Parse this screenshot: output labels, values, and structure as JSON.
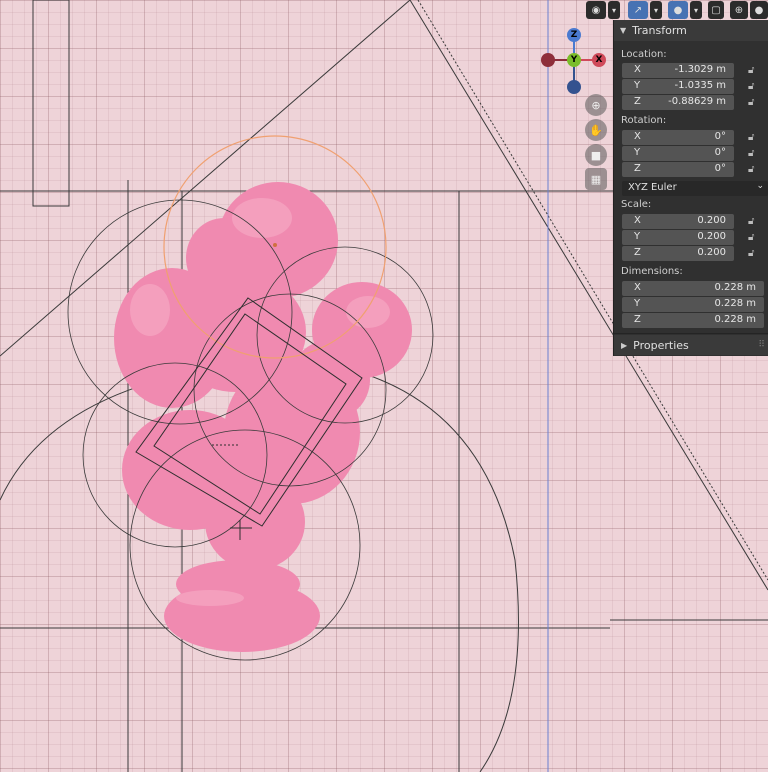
{
  "viewport": {
    "theme_colors": {
      "background": "#eed3d8",
      "object": "#f08ab0",
      "selection_outline": "#f0a070"
    }
  },
  "header": {
    "buttons": [
      {
        "icon": "eye-icon",
        "active": false
      },
      {
        "icon": "gizmo-arrows-icon",
        "active": true
      },
      {
        "icon": "overlay-circles-icon",
        "active": true
      },
      {
        "icon": "xray-toggle-icon",
        "active": false
      },
      {
        "icon": "shading-wireframe-icon",
        "active": false
      },
      {
        "icon": "shading-solid-icon",
        "active": false
      },
      {
        "icon": "shading-material-icon",
        "active": true
      },
      {
        "icon": "shading-rendered-icon",
        "active": false
      }
    ]
  },
  "gizmo": {
    "z": "Z",
    "y": "Y",
    "x": "X"
  },
  "panel": {
    "transform_title": "Transform",
    "location": {
      "label": "Location:",
      "x": {
        "label": "X",
        "value": "-1.3029 m"
      },
      "y": {
        "label": "Y",
        "value": "-1.0335 m"
      },
      "z": {
        "label": "Z",
        "value": "-0.88629 m"
      }
    },
    "rotation": {
      "label": "Rotation:",
      "x": {
        "label": "X",
        "value": "0°"
      },
      "y": {
        "label": "Y",
        "value": "0°"
      },
      "z": {
        "label": "Z",
        "value": "0°"
      },
      "mode": "XYZ Euler"
    },
    "scale": {
      "label": "Scale:",
      "x": {
        "label": "X",
        "value": "0.200"
      },
      "y": {
        "label": "Y",
        "value": "0.200"
      },
      "z": {
        "label": "Z",
        "value": "0.200"
      }
    },
    "dimensions": {
      "label": "Dimensions:",
      "x": {
        "label": "X",
        "value": "0.228 m"
      },
      "y": {
        "label": "Y",
        "value": "0.228 m"
      },
      "z": {
        "label": "Z",
        "value": "0.228 m"
      }
    },
    "properties_title": "Properties"
  }
}
